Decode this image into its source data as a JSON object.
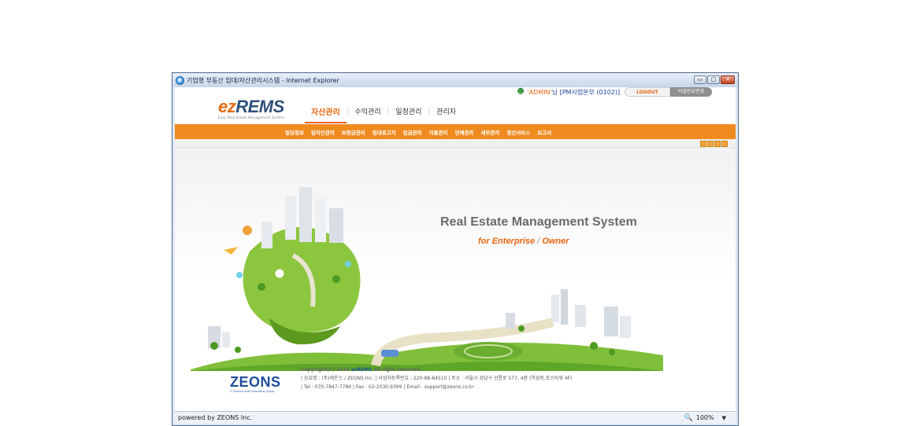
{
  "window": {
    "title": "기업형 부동산 임대/자산관리시스템 - Internet Explorer",
    "controls": {
      "minimize": "▭",
      "maximize": "▢",
      "close": "✕"
    }
  },
  "header": {
    "logo_main_e": "ez",
    "logo_main_rest": "REMS",
    "logo_sub": "Easy Real Estate Management System",
    "user_name": "'ADMIN'",
    "user_suffix": "님 [PM사업본부 (0102)]",
    "logout_label": "LOGOUT",
    "password_label": "비밀번호변경",
    "nav": [
      {
        "label": "자산관리",
        "active": true
      },
      {
        "label": "수익관리"
      },
      {
        "label": "일정관리"
      },
      {
        "label": "관리자"
      }
    ],
    "submenu": [
      "빌딩정보",
      "임차인관리",
      "보증금관리",
      "임대료고지",
      "입금관리",
      "지출관리",
      "연체관리",
      "세무관리",
      "영선서비스",
      "보고서"
    ]
  },
  "hero": {
    "title": "Real Estate Management System",
    "sub_a": "for Enterprise",
    "sub_sep": " / ",
    "sub_b": "Owner"
  },
  "footer": {
    "logo": "ZEONS",
    "logo_tag": "IT Service and Consulting Group",
    "copyright_pre": "Copyright(C) 2014 ",
    "copyright_brand": "ezREMS",
    "copyright_post": " All right reserved",
    "line1": "| 상호명 : (주)제온스 / ZEONS Inc.   | 사업자등록번호 : 220-88-84510   | 주소 : 서울시 강남구 선릉로 577, 4층 (역삼동,포스타워 4F)",
    "line2": "| Tel : 070-7847-7784   | Fax : 02-2030-9399   | Email : support@zeons.co.kr"
  },
  "statusbar": {
    "text": "powered by ZEONS Inc.",
    "zoom": "100%"
  },
  "colors": {
    "accent": "#ef8a1f",
    "brand_blue": "#1f4e9a",
    "hero_orange": "#e8650e"
  }
}
